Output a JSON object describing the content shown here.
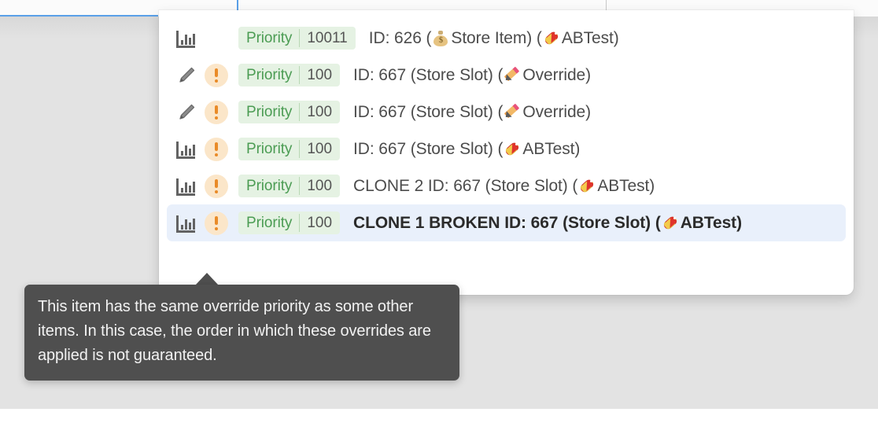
{
  "window": {
    "background_color": "#e3e3e3",
    "panel_background": "#ffffff",
    "accent_blue": "#5aa0e8",
    "selected_row_background": "#e9f0fb",
    "badge_background": "#e5f2e3",
    "badge_label_color": "#4b9c53",
    "warning_color": "#e98b28",
    "tooltip_background": "#4f4f4f"
  },
  "dropdown": {
    "name": "override-priority-dropdown",
    "options": [
      {
        "type_icon": "bar-chart-icon",
        "has_warning": false,
        "warning_icon": "",
        "badge_label": "Priority",
        "badge_value": "10011",
        "text_prefix": "",
        "text_main": "ID: 626 (",
        "source_emoji": "money-bag-emoji",
        "source_label": "Store Item",
        "text_middle": ") (",
        "kind_emoji": "pill-emoji",
        "kind_label": "ABTest",
        "text_suffix": ")",
        "selected": false
      },
      {
        "type_icon": "pencil-icon",
        "has_warning": true,
        "warning_icon": "warning-exclamation-icon",
        "badge_label": "Priority",
        "badge_value": "100",
        "text_prefix": "",
        "text_main": "ID: 667 (Store Slot) (",
        "source_emoji": "",
        "source_label": "",
        "text_middle": "",
        "kind_emoji": "pencil-emoji",
        "kind_label": "Override",
        "text_suffix": ")",
        "selected": false
      },
      {
        "type_icon": "pencil-icon",
        "has_warning": true,
        "warning_icon": "warning-exclamation-icon",
        "badge_label": "Priority",
        "badge_value": "100",
        "text_prefix": "",
        "text_main": "ID: 667 (Store Slot) (",
        "source_emoji": "",
        "source_label": "",
        "text_middle": "",
        "kind_emoji": "pencil-emoji",
        "kind_label": "Override",
        "text_suffix": ")",
        "selected": false
      },
      {
        "type_icon": "bar-chart-icon",
        "has_warning": true,
        "warning_icon": "warning-exclamation-icon",
        "badge_label": "Priority",
        "badge_value": "100",
        "text_prefix": "",
        "text_main": "ID: 667 (Store Slot) (",
        "source_emoji": "",
        "source_label": "",
        "text_middle": "",
        "kind_emoji": "pill-emoji",
        "kind_label": "ABTest",
        "text_suffix": ")",
        "selected": false
      },
      {
        "type_icon": "bar-chart-icon",
        "has_warning": true,
        "warning_icon": "warning-exclamation-icon",
        "badge_label": "Priority",
        "badge_value": "100",
        "text_prefix": "",
        "text_main": "CLONE 2 ID: 667 (Store Slot) (",
        "source_emoji": "",
        "source_label": "",
        "text_middle": "",
        "kind_emoji": "pill-emoji",
        "kind_label": "ABTest",
        "text_suffix": ")",
        "selected": false
      },
      {
        "type_icon": "bar-chart-icon",
        "has_warning": true,
        "warning_icon": "warning-exclamation-icon",
        "badge_label": "Priority",
        "badge_value": "100",
        "text_prefix": "",
        "text_main": "CLONE 1 BROKEN ID: 667 (Store Slot) (",
        "source_emoji": "",
        "source_label": "",
        "text_middle": "",
        "kind_emoji": "pill-emoji",
        "kind_label": "ABTest",
        "text_suffix": ")",
        "selected": true
      }
    ]
  },
  "tooltip": {
    "name": "same-priority-warning-tooltip",
    "text": "This item has the same override priority as some other items. In this case, the order in which these overrides are applied is not guaranteed."
  }
}
